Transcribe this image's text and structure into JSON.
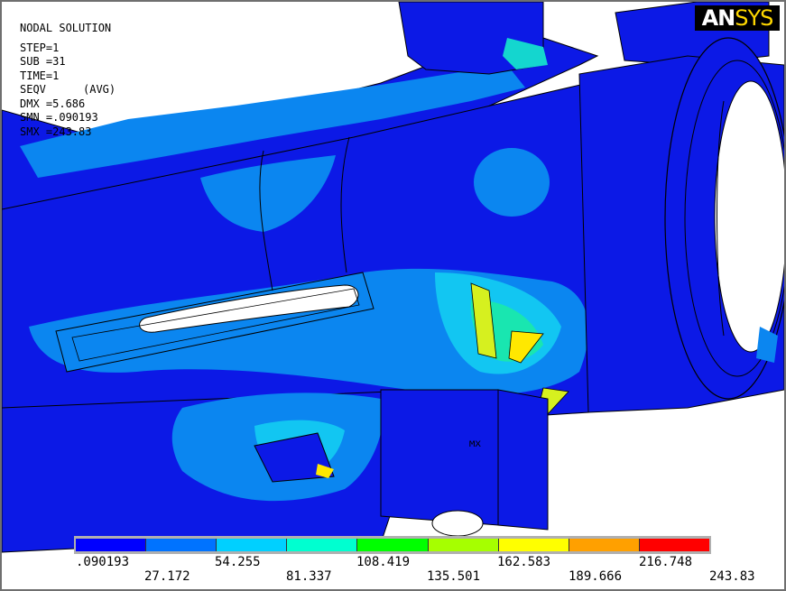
{
  "info": {
    "title": "NODAL SOLUTION",
    "step": "STEP=1",
    "sub": "SUB =31",
    "time": "TIME=1",
    "seqv": "SEQV",
    "avg": "(AVG)",
    "dmx": "DMX =5.686",
    "smn": "SMN =.090193",
    "smx": "SMX =243.83"
  },
  "logo": {
    "an": "AN",
    "sys": "SYS"
  },
  "mx_marker": "MX",
  "legend": {
    "colors": [
      "#0000ff",
      "#0073ff",
      "#00d0ff",
      "#00ffd0",
      "#00ff00",
      "#a6ff00",
      "#ffff00",
      "#ffa000",
      "#ff0000"
    ],
    "top_labels": [
      ".090193",
      "54.255",
      "108.419",
      "162.583",
      "216.748"
    ],
    "bottom_labels": [
      "27.172",
      "81.337",
      "135.501",
      "189.666",
      "243.83"
    ]
  }
}
